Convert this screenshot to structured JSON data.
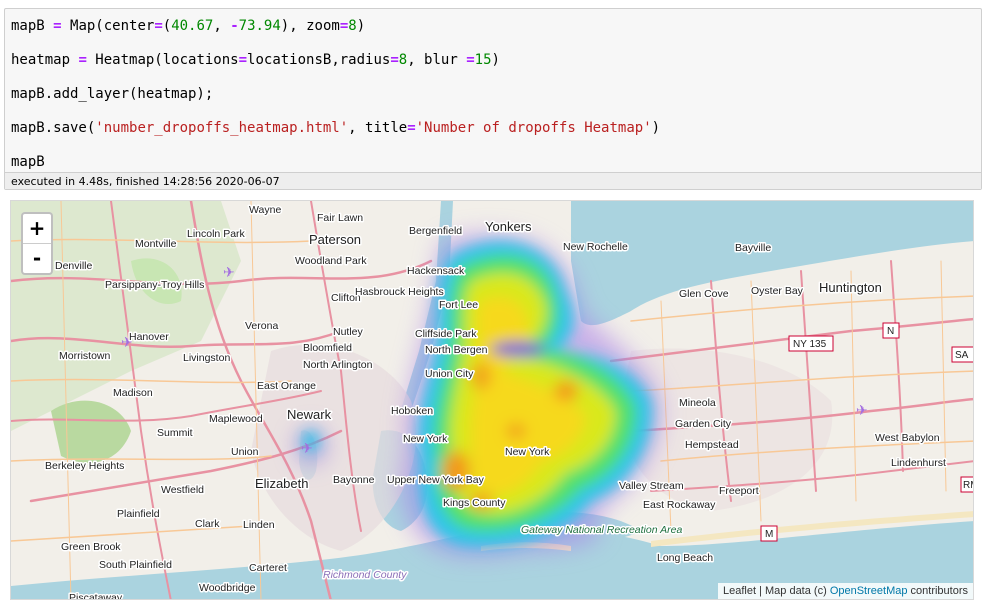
{
  "cell": {
    "code_lines": [
      [
        {
          "t": "mapB "
        },
        {
          "t": "=",
          "c": "kw-op"
        },
        {
          "t": " Map(center"
        },
        {
          "t": "=",
          "c": "kw-op"
        },
        {
          "t": "("
        },
        {
          "t": "40.67",
          "c": "num"
        },
        {
          "t": ", "
        },
        {
          "t": "-",
          "c": "kw-op"
        },
        {
          "t": "73.94",
          "c": "num"
        },
        {
          "t": "), zoom"
        },
        {
          "t": "=",
          "c": "kw-op"
        },
        {
          "t": "8",
          "c": "num"
        },
        {
          "t": ")"
        }
      ],
      [
        {
          "t": "heatmap "
        },
        {
          "t": "=",
          "c": "kw-op"
        },
        {
          "t": " Heatmap(locations"
        },
        {
          "t": "=",
          "c": "kw-op"
        },
        {
          "t": "locationsB,radius"
        },
        {
          "t": "=",
          "c": "kw-op"
        },
        {
          "t": "8",
          "c": "num"
        },
        {
          "t": ", blur "
        },
        {
          "t": "=",
          "c": "kw-op"
        },
        {
          "t": "15",
          "c": "num"
        },
        {
          "t": ")"
        }
      ],
      [
        {
          "t": "mapB.add_layer(heatmap);"
        }
      ],
      [
        {
          "t": "mapB.save("
        },
        {
          "t": "'number_dropoffs_heatmap.html'",
          "c": "str"
        },
        {
          "t": ", title"
        },
        {
          "t": "=",
          "c": "kw-op"
        },
        {
          "t": "'Number of dropoffs Heatmap'",
          "c": "str"
        },
        {
          "t": ")"
        }
      ],
      [
        {
          "t": "mapB"
        }
      ]
    ],
    "exec_status": "executed in 4.48s, finished 14:28:56 2020-06-07"
  },
  "map": {
    "zoom_in": "+",
    "zoom_out": "-",
    "attribution_prefix": "Leaflet | Map data (c) ",
    "attribution_link": "OpenStreetMap",
    "attribution_suffix": " contributors",
    "places": [
      "Wayne",
      "Fair Lawn",
      "Yonkers",
      "Lincoln Park",
      "Montville",
      "Paterson",
      "Bergenfield",
      "New Rochelle",
      "Bayville",
      "Denville",
      "Woodland Park",
      "Hackensack",
      "Parsippany-Troy Hills",
      "Clifton",
      "Hasbrouck Heights",
      "Fort Lee",
      "Glen Cove",
      "Oyster Bay",
      "Huntington",
      "Hanover",
      "Verona",
      "Nutley",
      "Cliffside Park",
      "Morristown",
      "Livingston",
      "Bloomfield",
      "North Bergen",
      "North Arlington",
      "Union City",
      "Madison",
      "East Orange",
      "Mineola",
      "Maplewood",
      "Newark",
      "Hoboken",
      "New York",
      "Garden City",
      "Summit",
      "Union",
      "New York",
      "Hempstead",
      "West Babylon",
      "Berkeley Heights",
      "Elizabeth",
      "Bayonne",
      "Valley Stream",
      "Lindenhurst",
      "Westfield",
      "Upper New York Bay",
      "Kings County",
      "Freeport",
      "East Rockaway",
      "Plainfield",
      "Clark",
      "Linden",
      "Gateway National Recreation Area",
      "Long Beach",
      "Green Brook",
      "South Plainfield",
      "Carteret",
      "Richmond County",
      "Piscataway",
      "Woodbridge"
    ],
    "road_shields": [
      "NY 135",
      "N",
      "SA",
      "M",
      "RM"
    ],
    "colors": {
      "water": "#aad3df",
      "land": "#f2efe9",
      "park": "#c8e6b3",
      "road_major": "#e892a2",
      "road": "#f8c896",
      "airport": "#a36ee0"
    }
  }
}
